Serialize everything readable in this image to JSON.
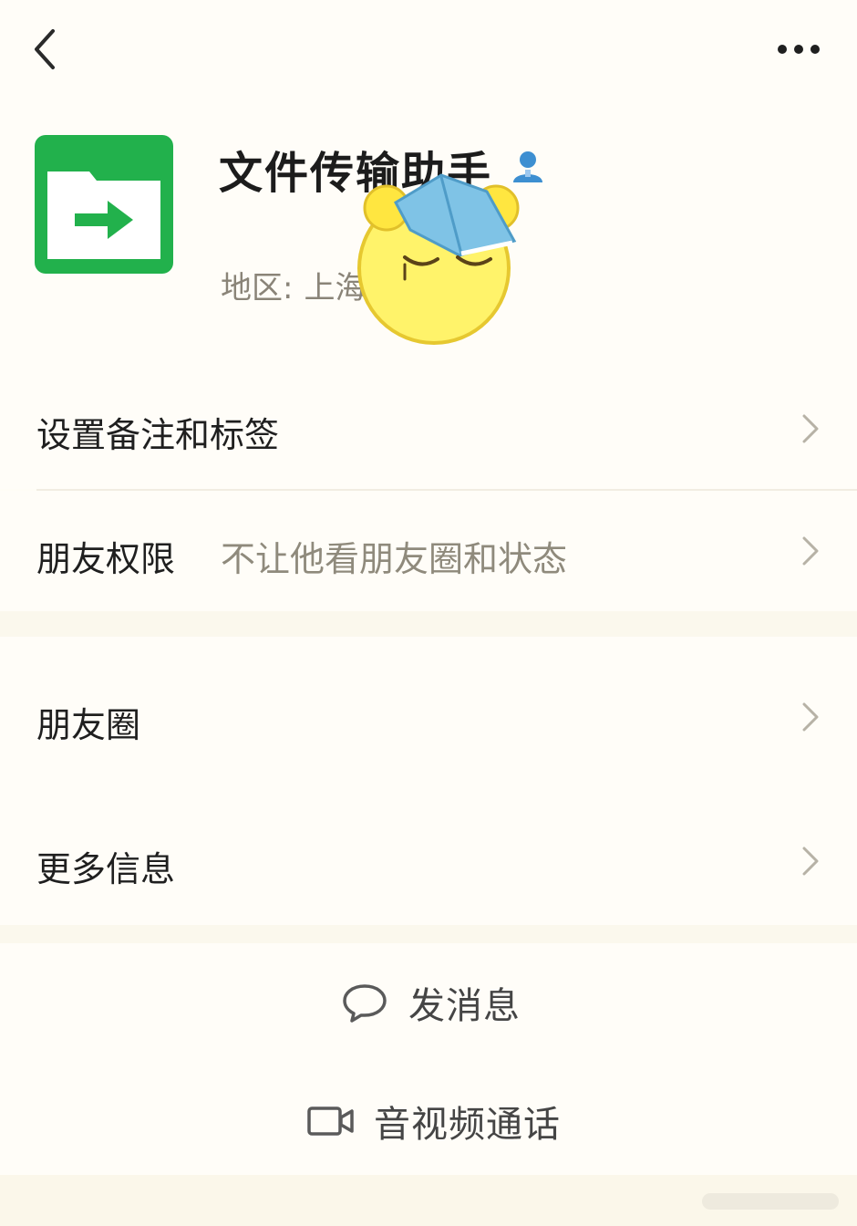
{
  "header": {
    "back_icon": "chevron-left-icon",
    "more_icon": "more-horizontal-icon"
  },
  "profile": {
    "name": "文件传输助手",
    "region_label": "地区:",
    "region_value": "上海",
    "avatar_icon": "folder-arrow-icon",
    "verify_icon": "person-badge-icon",
    "accent_color": "#1aad19"
  },
  "rows": {
    "remark_tags": {
      "label": "设置备注和标签"
    },
    "friend_permissions": {
      "label": "朋友权限",
      "value": "不让他看朋友圈和状态"
    },
    "moments": {
      "label": "朋友圈"
    },
    "more_info": {
      "label": "更多信息"
    }
  },
  "actions": {
    "send_message": {
      "label": "发消息",
      "icon": "chat-bubble-icon"
    },
    "av_call": {
      "label": "音视频通话",
      "icon": "video-camera-icon"
    }
  }
}
